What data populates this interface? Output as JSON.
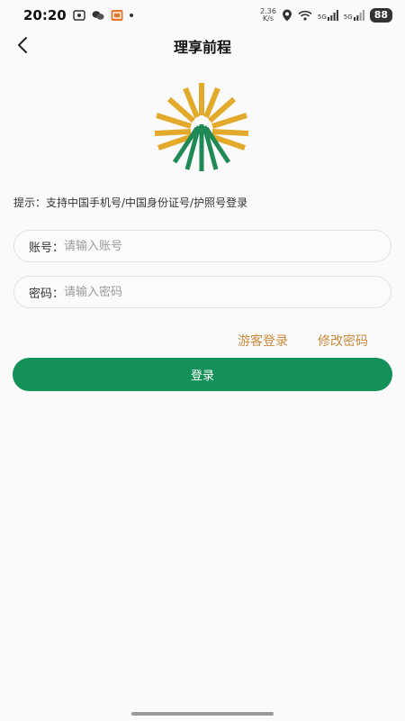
{
  "status_bar": {
    "time": "20:20",
    "net_speed_value": "2.36",
    "net_speed_unit": "K/s",
    "signal_label_1": "5G",
    "signal_label_2": "5G",
    "battery": "88"
  },
  "nav": {
    "title": "理享前程"
  },
  "login": {
    "hint": "提示：支持中国手机号/中国身份证号/护照号登录",
    "account": {
      "label": "账号：",
      "placeholder": "请输入账号",
      "value": ""
    },
    "password": {
      "label": "密码：",
      "placeholder": "请输入密码",
      "value": ""
    },
    "guest_login": "游客登录",
    "change_password": "修改密码",
    "submit_label": "登录"
  },
  "colors": {
    "primary_green": "#149158",
    "link_orange": "#c88a3a",
    "logo_gold": "#e3a92a",
    "logo_green": "#1f8a55"
  }
}
